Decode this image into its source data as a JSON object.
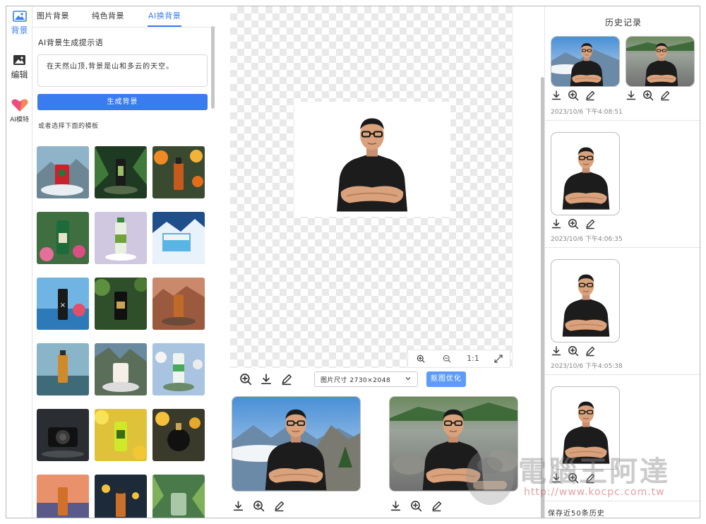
{
  "rail": {
    "items": [
      {
        "label": "背景",
        "icon": "image-icon",
        "active": true
      },
      {
        "label": "编辑",
        "icon": "edit-image-icon",
        "active": false
      },
      {
        "label": "AI模特",
        "icon": "heart-icon",
        "active": false
      }
    ]
  },
  "panel": {
    "tabs": [
      "图片背景",
      "纯色背景",
      "AI换背景"
    ],
    "active_tab": "AI换背景",
    "prompt_label": "AI背景生成提示语",
    "prompt_value": "在天然山顶,背景是山和多云的天空。",
    "generate_button": "生成背景",
    "template_hint": "或者选择下面的模板",
    "templates": [
      {
        "name": "red-cup-mountain"
      },
      {
        "name": "dark-bottle-jungle"
      },
      {
        "name": "amber-bottle-flowers"
      },
      {
        "name": "green-bottle-garden"
      },
      {
        "name": "water-bottle-pedestal"
      },
      {
        "name": "blue-box-snow"
      },
      {
        "name": "black-bottle-ocean"
      },
      {
        "name": "black-bottle-leaves"
      },
      {
        "name": "amber-bottle-canyon"
      },
      {
        "name": "whisky-seaside"
      },
      {
        "name": "candle-rock"
      },
      {
        "name": "green-bottle-spheres"
      },
      {
        "name": "camera-rain"
      },
      {
        "name": "yellow-bottle-lemons"
      },
      {
        "name": "perfume-gold-flowers"
      },
      {
        "name": "dropper-sunset"
      },
      {
        "name": "bottle-gold-bokeh"
      },
      {
        "name": "jar-plants"
      }
    ]
  },
  "canvas": {
    "zoom_in": "zoom-in-icon",
    "zoom_out": "zoom-out-icon",
    "ratio_label": "1:1",
    "fullscreen": "expand-icon",
    "size_select": "图片尺寸 2730×2048",
    "refine_button": "抠图优化"
  },
  "results": [
    {
      "name": "result-mountain-clouds"
    },
    {
      "name": "result-rocky-mountain"
    }
  ],
  "history": {
    "title": "历史记录",
    "entries": [
      {
        "time": "2023/10/6 下午4:08:51"
      },
      {
        "time": "2023/10/6 下午4:06:35"
      },
      {
        "time": "2023/10/6 下午4:05:38"
      },
      {
        "time": ""
      }
    ],
    "footer": "保存近50条历史"
  },
  "watermark": {
    "text": "電腦王阿達",
    "url": "http://www.kocpc.com.tw"
  },
  "colors": {
    "accent": "#3b7bf0",
    "shirt": "#1c1c1c",
    "skin": "#d9a27c"
  }
}
